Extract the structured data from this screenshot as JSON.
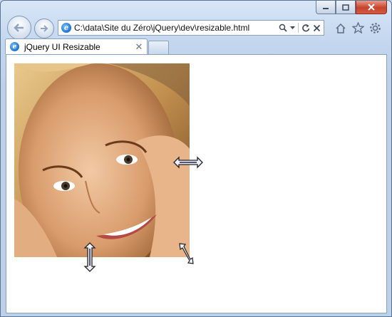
{
  "window": {
    "caption_buttons": [
      "minimize",
      "maximize",
      "close"
    ]
  },
  "toolbar": {
    "address_url": "C:\\data\\Site du Zéro\\jQuery\\dev\\resizable.html",
    "icons": [
      "back-icon",
      "forward-icon",
      "search-icon",
      "dropdown-icon",
      "refresh-icon",
      "stop-icon",
      "home-icon",
      "favorites-star-icon",
      "tools-gear-icon"
    ]
  },
  "tabs": [
    {
      "title": "jQuery UI Resizable",
      "active": true
    }
  ],
  "content": {
    "image_alt": "portrait photo of smiling woman",
    "resize_handles": [
      "east-resize-cursor",
      "south-resize-cursor",
      "southeast-resize-cursor"
    ]
  },
  "colors": {
    "frame": "#c3d6ee",
    "close_button": "#c7432c",
    "content_bg": "#ffffff"
  }
}
